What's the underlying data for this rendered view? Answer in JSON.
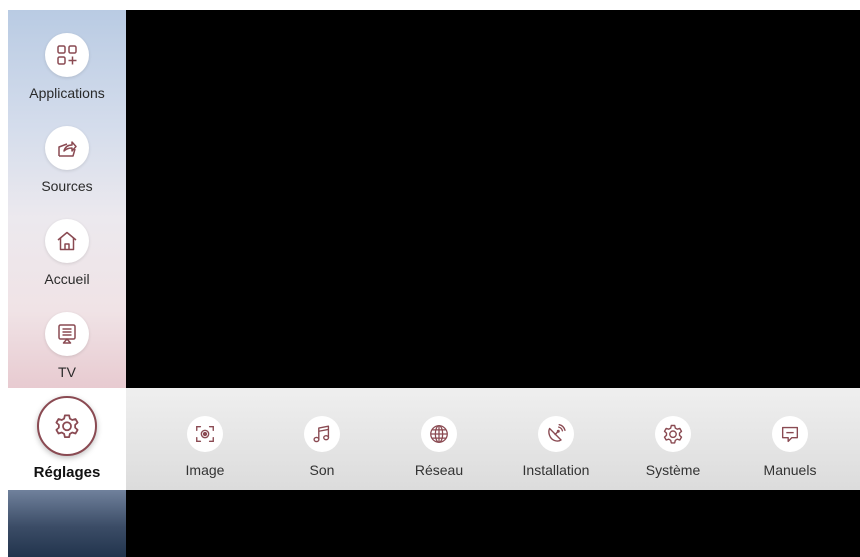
{
  "sidebar": {
    "items": [
      {
        "label": "Applications",
        "icon": "apps-icon"
      },
      {
        "label": "Sources",
        "icon": "sources-icon"
      },
      {
        "label": "Accueil",
        "icon": "home-icon"
      },
      {
        "label": "TV",
        "icon": "tv-icon"
      }
    ],
    "selected": {
      "label": "Réglages",
      "icon": "settings-gear-icon"
    }
  },
  "settings_menu": {
    "items": [
      {
        "label": "Image",
        "icon": "image-icon"
      },
      {
        "label": "Son",
        "icon": "music-note-icon"
      },
      {
        "label": "Réseau",
        "icon": "globe-icon"
      },
      {
        "label": "Installation",
        "icon": "satellite-dish-icon"
      },
      {
        "label": "Système",
        "icon": "gear-icon"
      },
      {
        "label": "Manuels",
        "icon": "chat-bubble-icon"
      }
    ]
  },
  "colors": {
    "icon_accent": "#8a4a52",
    "selected_border": "#8a4a52",
    "screen_background": "#000000"
  }
}
